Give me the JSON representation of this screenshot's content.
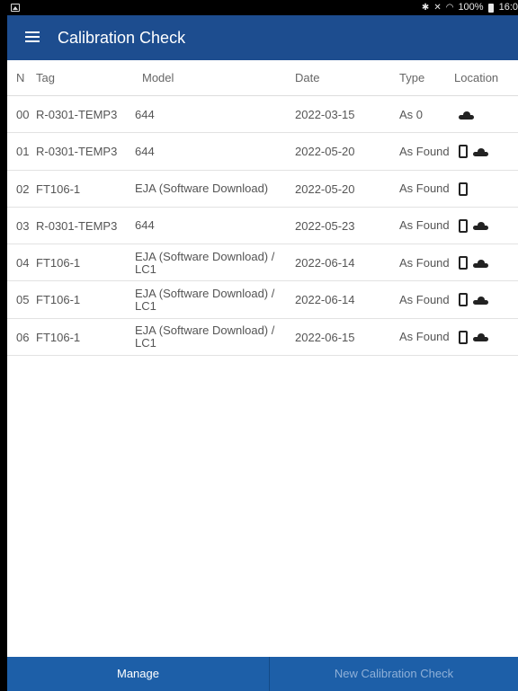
{
  "status_bar": {
    "icons": [
      "gallery-icon",
      "bluetooth-icon",
      "mute-icon",
      "wifi-icon",
      "battery-icon"
    ],
    "battery": "100%",
    "time": "16:0"
  },
  "app_bar": {
    "title": "Calibration Check",
    "menu_icon": "hamburger-menu-icon",
    "color": "#1d4d8f"
  },
  "table": {
    "headers": {
      "n": "N",
      "tag": "Tag",
      "model": "Model",
      "date": "Date",
      "type": "Type",
      "location": "Location"
    },
    "rows": [
      {
        "n": "00",
        "tag": "R-0301-TEMP3",
        "model": "644",
        "date": "2022-03-15",
        "type": "As 0",
        "location": [
          "cloud"
        ]
      },
      {
        "n": "01",
        "tag": "R-0301-TEMP3",
        "model": "644",
        "date": "2022-05-20",
        "type": "As Found",
        "location": [
          "device",
          "cloud"
        ]
      },
      {
        "n": "02",
        "tag": "FT106-1",
        "model": "EJA (Software Download)",
        "date": "2022-05-20",
        "type": "As Found",
        "location": [
          "device"
        ]
      },
      {
        "n": "03",
        "tag": "R-0301-TEMP3",
        "model": "644",
        "date": "2022-05-23",
        "type": "As Found",
        "location": [
          "device",
          "cloud"
        ]
      },
      {
        "n": "04",
        "tag": "FT106-1",
        "model": "EJA (Software Download) / LC1",
        "date": "2022-06-14",
        "type": "As Found",
        "location": [
          "device",
          "cloud"
        ]
      },
      {
        "n": "05",
        "tag": "FT106-1",
        "model": "EJA (Software Download) / LC1",
        "date": "2022-06-14",
        "type": "As Found",
        "location": [
          "device",
          "cloud"
        ]
      },
      {
        "n": "06",
        "tag": "FT106-1",
        "model": "EJA (Software Download) / LC1",
        "date": "2022-06-15",
        "type": "As Found",
        "location": [
          "device",
          "cloud"
        ]
      }
    ]
  },
  "bottom_bar": {
    "manage_label": "Manage",
    "new_label": "New Calibration Check",
    "new_enabled": false,
    "color": "#1d5fa8"
  }
}
